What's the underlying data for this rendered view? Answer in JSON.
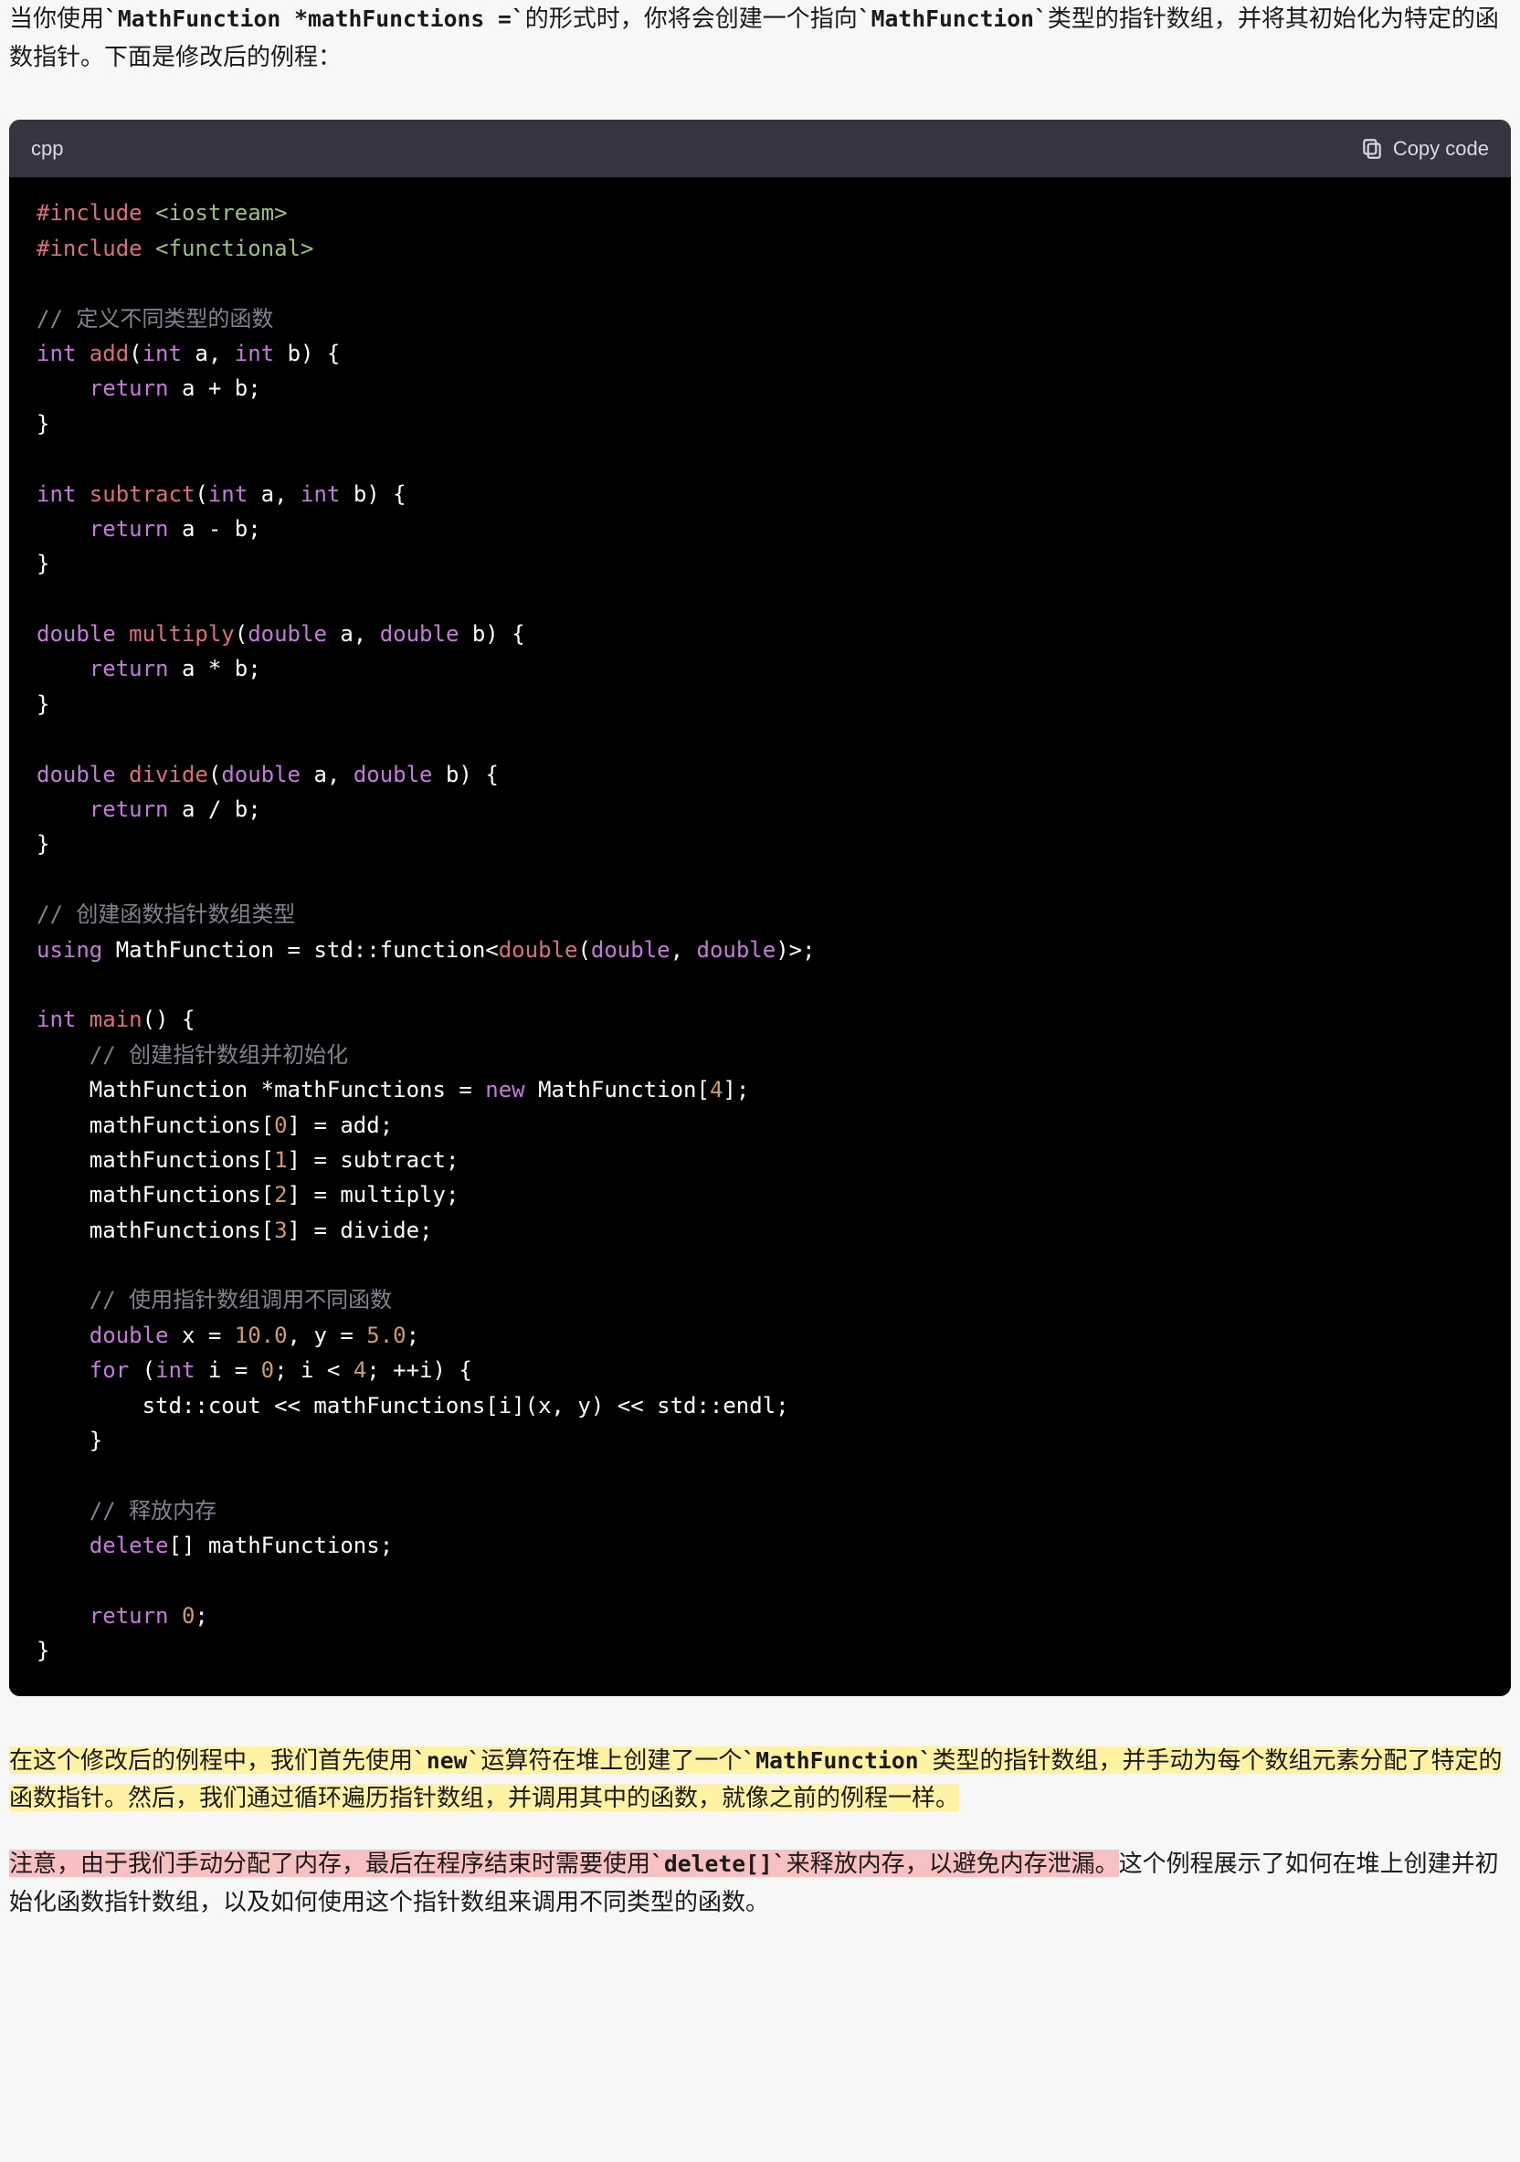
{
  "intro": {
    "t1": "当你使用",
    "c1": "`MathFunction *mathFunctions =`",
    "t2": "的形式时，你将会创建一个指向",
    "c2": "`MathFunction`",
    "t3": "类型的指针数组，并将其初始化为特定的函数指针。下面是修改后的例程："
  },
  "code": {
    "lang": "cpp",
    "copy_label": "Copy code",
    "lines": {
      "l01a": "#include",
      "l01b": " <iostream>",
      "l02a": "#include",
      "l02b": " <functional>",
      "l04": "// 定义不同类型的函数",
      "l05a": "int",
      "l05b": " add",
      "l05c": "(",
      "l05d": "int",
      "l05e": " a, ",
      "l05f": "int",
      "l05g": " b) {",
      "l06a": "    return",
      "l06b": " a + b;",
      "l07": "}",
      "l09a": "int",
      "l09b": " subtract",
      "l09c": "(",
      "l09d": "int",
      "l09e": " a, ",
      "l09f": "int",
      "l09g": " b) {",
      "l10a": "    return",
      "l10b": " a - b;",
      "l11": "}",
      "l13a": "double",
      "l13b": " multiply",
      "l13c": "(",
      "l13d": "double",
      "l13e": " a, ",
      "l13f": "double",
      "l13g": " b) {",
      "l14a": "    return",
      "l14b": " a * b;",
      "l15": "}",
      "l17a": "double",
      "l17b": " divide",
      "l17c": "(",
      "l17d": "double",
      "l17e": " a, ",
      "l17f": "double",
      "l17g": " b) {",
      "l18a": "    return",
      "l18b": " a / b;",
      "l19": "}",
      "l21": "// 创建函数指针数组类型",
      "l22a": "using",
      "l22b": " MathFunction = std::function<",
      "l22c": "double",
      "l22d": "(",
      "l22e": "double",
      "l22f": ", ",
      "l22g": "double",
      "l22h": ")>;",
      "l24a": "int",
      "l24b": " main",
      "l24c": "() {",
      "l25": "    // 创建指针数组并初始化",
      "l26a": "    MathFunction *mathFunctions = ",
      "l26b": "new",
      "l26c": " MathFunction[",
      "l26d": "4",
      "l26e": "];",
      "l27a": "    mathFunctions[",
      "l27b": "0",
      "l27c": "] = add;",
      "l28a": "    mathFunctions[",
      "l28b": "1",
      "l28c": "] = subtract;",
      "l29a": "    mathFunctions[",
      "l29b": "2",
      "l29c": "] = multiply;",
      "l30a": "    mathFunctions[",
      "l30b": "3",
      "l30c": "] = divide;",
      "l32": "    // 使用指针数组调用不同函数",
      "l33a": "    double",
      "l33b": " x = ",
      "l33c": "10.0",
      "l33d": ", y = ",
      "l33e": "5.0",
      "l33f": ";",
      "l34a": "    for",
      "l34b": " (",
      "l34c": "int",
      "l34d": " i = ",
      "l34e": "0",
      "l34f": "; i < ",
      "l34g": "4",
      "l34h": "; ++i) {",
      "l35": "        std::cout << mathFunctions[i](x, y) << std::endl;",
      "l36": "    }",
      "l38": "    // 释放内存",
      "l39a": "    delete",
      "l39b": "[] mathFunctions;",
      "l41a": "    return",
      "l41b": " ",
      "l41c": "0",
      "l41d": ";",
      "l42": "}"
    }
  },
  "para2": {
    "h1a": "在这个修改后的例程中，我们首先使用",
    "h1b": "`new`",
    "h1c": "运算符在堆上创建了一个",
    "h1d": "`MathFunction`",
    "h1e": "类型的指针数组，并手动为每个数组元素分配了特定的函数指针。然后，我们通过循环遍历指针数组，并调用其中的函数，就像之前的例程一样。"
  },
  "para3": {
    "r1a": "注意，由于我们手动分配了内存，最后在程序结束时需要使用",
    "r1b": "`delete[]`",
    "r1c": "来释放内存，以避免内存泄漏。",
    "t2": "这个例程展示了如何在堆上创建并初始化函数指针数组，以及如何使用这个指针数组来调用不同类型的函数。"
  }
}
